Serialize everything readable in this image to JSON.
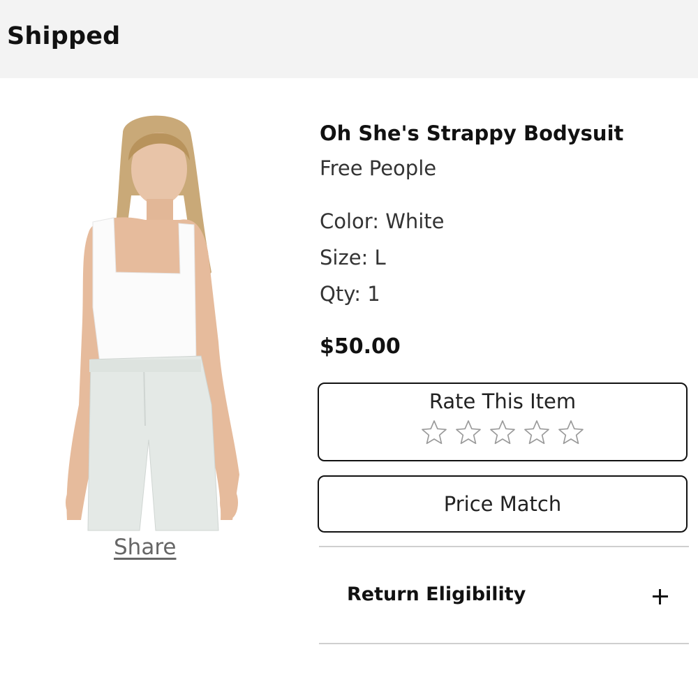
{
  "order": {
    "status": "Shipped"
  },
  "product": {
    "name": "Oh She's Strappy Bodysuit",
    "brand": "Free People",
    "color_text": "Color: White",
    "size_text": "Size: L",
    "qty_text": "Qty: 1",
    "price": "$50.00",
    "image_icon": "product-photo"
  },
  "actions": {
    "share_label": "Share",
    "rate_label": "Rate This Item",
    "rating_value": 0,
    "rating_max": 5,
    "price_match_label": "Price Match",
    "return_label": "Return Eligibility",
    "return_expand_icon": "plus-icon"
  },
  "colors": {
    "header_bg": "#f3f3f3",
    "text": "#111111",
    "divider": "#cfcfcf",
    "star_outline": "#9a9a9a"
  }
}
